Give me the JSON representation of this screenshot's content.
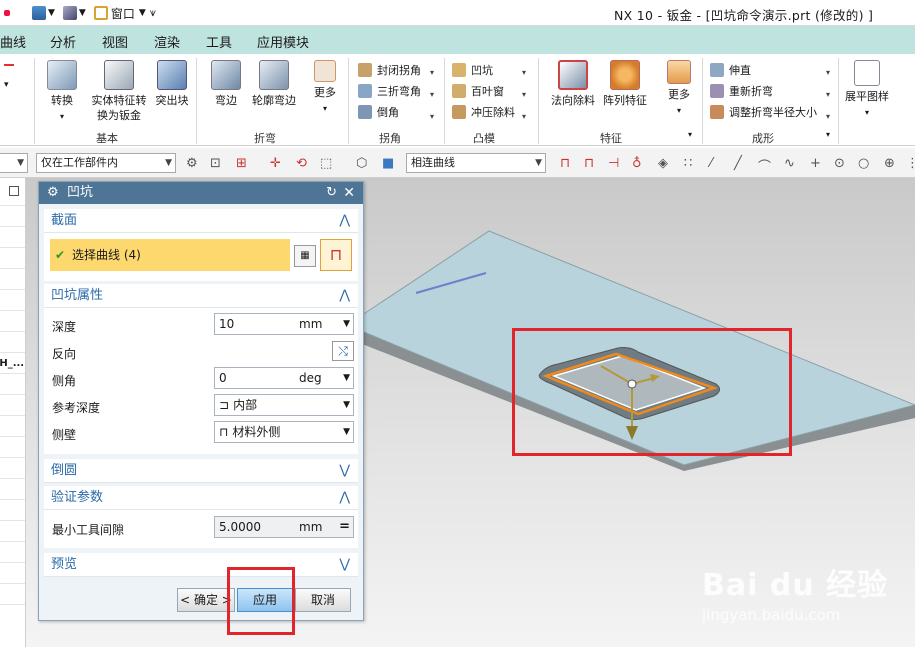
{
  "window": {
    "title": "NX 10 - 钣金 - [凹坑命令演示.prt  (修改的) ]",
    "quick_access": {
      "window_menu": "窗口"
    }
  },
  "menu_tabs": [
    "曲线",
    "分析",
    "视图",
    "渲染",
    "工具",
    "应用模块"
  ],
  "ribbon": {
    "groups": {
      "basic": "基本",
      "bend": "折弯",
      "corner": "拐角",
      "convex": "凸模",
      "feature": "特征",
      "forming": "成形"
    },
    "buttons": {
      "convert": "转换",
      "solid_to_sheet_1": "实体特征转",
      "solid_to_sheet_2": "换为钣金",
      "tab": "突出块",
      "flange": "弯边",
      "contour_flange": "轮廓弯边",
      "more_bend": "更多",
      "closed_corner": "封闭拐角",
      "three_bend_corner": "三折弯角",
      "chamfer": "倒角",
      "dimple": "凹坑",
      "louver": "百叶窗",
      "drawn_cutout": "冲压除料",
      "normal_cutout": "法向除料",
      "pattern_feature": "阵列特征",
      "more_feature": "更多",
      "unbend": "伸直",
      "rebend": "重新折弯",
      "adjust_bend_radius": "调整折弯半径大小",
      "flat_pattern": "展平图样"
    }
  },
  "toolbar2": {
    "scope_filter": "仅在工作部件内",
    "curve_rule": "相连曲线"
  },
  "left_nav": {
    "label": "CH_..."
  },
  "dialog": {
    "title": "凹坑",
    "section_section": {
      "title": "截面",
      "select_curve": "选择曲线 (4)"
    },
    "section_properties": {
      "title": "凹坑属性",
      "depth_label": "深度",
      "depth_value": "10",
      "depth_unit": "mm",
      "reverse_label": "反向",
      "side_angle_label": "侧角",
      "side_angle_value": "0",
      "side_angle_unit": "deg",
      "ref_depth_label": "参考深度",
      "ref_depth_value": "内部",
      "side_wall_label": "侧壁",
      "side_wall_value": "材料外侧"
    },
    "section_fillet": {
      "title": "倒圆"
    },
    "section_validation": {
      "title": "验证参数",
      "min_tool_clearance_label": "最小工具间隙",
      "min_tool_clearance_value": "5.0000",
      "min_tool_clearance_unit": "mm"
    },
    "section_preview": {
      "title": "预览"
    },
    "buttons": {
      "ok": "< 确定 >",
      "apply": "应用",
      "cancel": "取消"
    }
  },
  "watermark": {
    "brand": "Bai du 经验",
    "url": "jingyan.baidu.com"
  },
  "colors": {
    "menu_bar": "#bfe3df",
    "dialog_title": "#4f7596",
    "selection_highlight": "#fdd86e",
    "annotation_red": "#e0262b",
    "apply_button": "#a9d3f5",
    "section_header_text": "#2a6aa8"
  }
}
